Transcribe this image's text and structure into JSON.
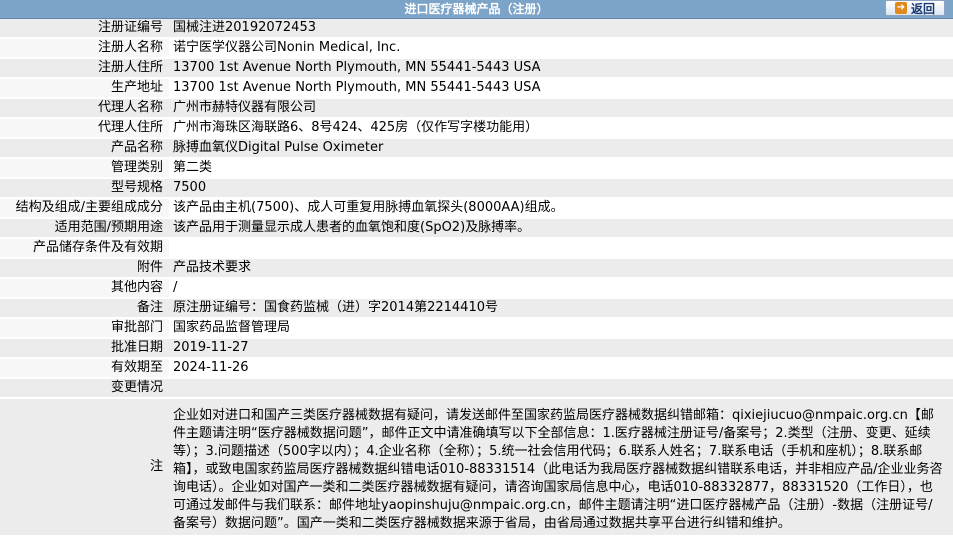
{
  "header": {
    "title": "进口医疗器械产品（注册）",
    "back_label": "返回"
  },
  "rows": [
    {
      "label": "注册证编号",
      "value": "国械注进20192072453"
    },
    {
      "label": "注册人名称",
      "value": "诺宁医学仪器公司Nonin Medical, Inc."
    },
    {
      "label": "注册人住所",
      "value": "13700 1st Avenue North Plymouth, MN 55441-5443 USA"
    },
    {
      "label": "生产地址",
      "value": "13700 1st Avenue North Plymouth, MN 55441-5443 USA"
    },
    {
      "label": "代理人名称",
      "value": "广州市赫特仪器有限公司"
    },
    {
      "label": "代理人住所",
      "value": "广州市海珠区海联路6、8号424、425房（仅作写字楼功能用）"
    },
    {
      "label": "产品名称",
      "value": "脉搏血氧仪Digital Pulse Oximeter"
    },
    {
      "label": "管理类别",
      "value": "第二类"
    },
    {
      "label": "型号规格",
      "value": "7500"
    },
    {
      "label": "结构及组成/主要组成成分",
      "value": "该产品由主机(7500)、成人可重复用脉搏血氧探头(8000AA)组成。"
    },
    {
      "label": "适用范围/预期用途",
      "value": "该产品用于测量显示成人患者的血氧饱和度(SpO2)及脉搏率。"
    },
    {
      "label": "产品储存条件及有效期",
      "value": ""
    },
    {
      "label": "附件",
      "value": "产品技术要求"
    },
    {
      "label": "其他内容",
      "value": "/"
    },
    {
      "label": "备注",
      "value": "原注册证编号：国食药监械（进）字2014第2214410号"
    },
    {
      "label": "审批部门",
      "value": "国家药品监督管理局"
    },
    {
      "label": "批准日期",
      "value": "2019-11-27"
    },
    {
      "label": "有效期至",
      "value": "2024-11-26"
    },
    {
      "label": "变更情况",
      "value": ""
    }
  ],
  "note": {
    "label": "注",
    "text": "企业如对进口和国产三类医疗器械数据有疑问，请发送邮件至国家药监局医疗器械数据纠错邮箱：qixiejiucuo@nmpaic.org.cn【邮件主题请注明“医疗器械数据问题”，邮件正文中请准确填写以下全部信息：1.医疗器械注册证号/备案号；2.类型（注册、变更、延续等）；3.问题描述（500字以内）；4.企业名称（全称）；5.统一社会信用代码；6.联系人姓名；7.联系电话（手机和座机）；8.联系邮箱】，或致电国家药监局医疗器械数据纠错电话010-88331514（此电话为我局医疗器械数据纠错联系电话，并非相应产品/企业业务咨询电话）。企业如对国产一类和二类医疗器械数据有疑问，请咨询国家局信息中心，电话010-88332877，88331520（工作日），也可通过发邮件与我们联系：邮件地址yaopinshuju@nmpaic.org.cn，邮件主题请注明“进口医疗器械产品（注册）-数据（注册证号/备案号）数据问题”。国产一类和二类医疗器械数据来源于省局，由省局通过数据共享平台进行纠错和维护。"
  }
}
